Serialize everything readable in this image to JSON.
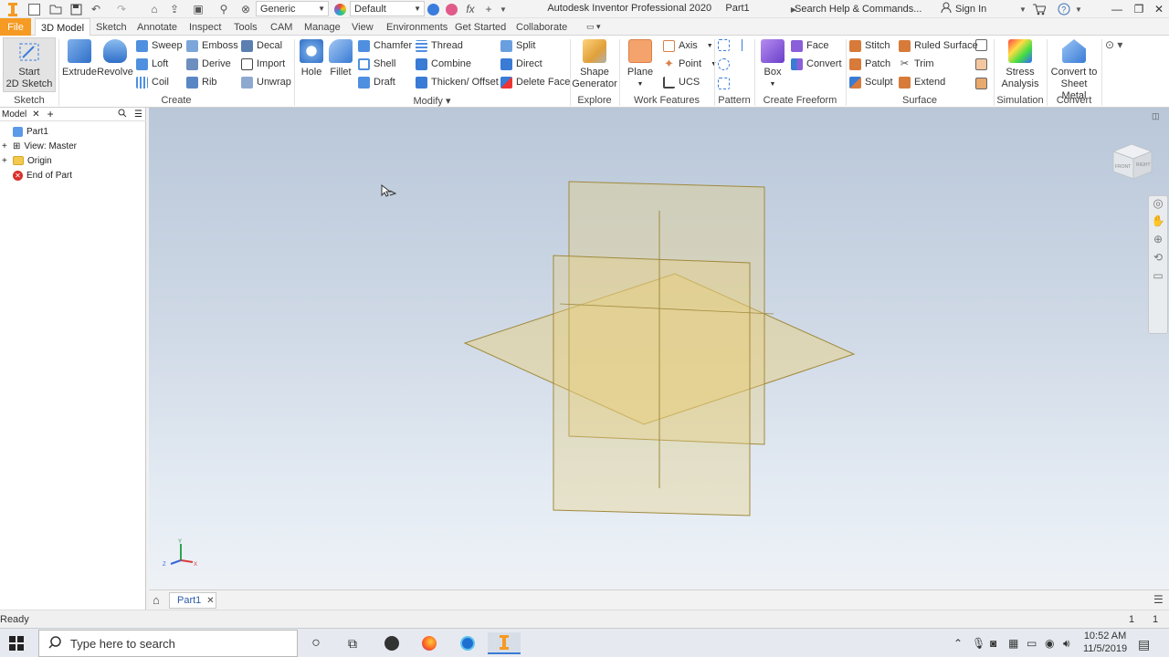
{
  "titlebar": {
    "app_title": "Autodesk Inventor Professional 2020",
    "doc_name": "Part1",
    "material_combo": "Generic",
    "appearance_combo": "Default",
    "search_placeholder": "Search Help & Commands...",
    "sign_in": "Sign In"
  },
  "tabs": [
    "File",
    "3D Model",
    "Sketch",
    "Annotate",
    "Inspect",
    "Tools",
    "CAM",
    "Manage",
    "View",
    "Environments",
    "Get Started",
    "Collaborate"
  ],
  "active_tab": "3D Model",
  "ribbon": {
    "sketch": {
      "start_label_1": "Start",
      "start_label_2": "2D Sketch",
      "group": "Sketch"
    },
    "create": {
      "extrude": "Extrude",
      "revolve": "Revolve",
      "sweep": "Sweep",
      "loft": "Loft",
      "coil": "Coil",
      "emboss": "Emboss",
      "derive": "Derive",
      "rib": "Rib",
      "decal": "Decal",
      "import": "Import",
      "unwrap": "Unwrap",
      "group": "Create"
    },
    "modify": {
      "hole": "Hole",
      "fillet": "Fillet",
      "chamfer": "Chamfer",
      "shell": "Shell",
      "draft": "Draft",
      "thread": "Thread",
      "combine": "Combine",
      "thicken": "Thicken/ Offset",
      "split": "Split",
      "direct": "Direct",
      "delete_face": "Delete Face",
      "group": "Modify"
    },
    "explore": {
      "shape_gen_1": "Shape",
      "shape_gen_2": "Generator",
      "group": "Explore"
    },
    "work": {
      "plane": "Plane",
      "axis": "Axis",
      "point": "Point",
      "ucs": "UCS",
      "group": "Work Features"
    },
    "pattern": {
      "group": "Pattern"
    },
    "freeform": {
      "box": "Box",
      "face": "Face",
      "convert": "Convert",
      "group": "Create Freeform"
    },
    "surface": {
      "stitch": "Stitch",
      "patch": "Patch",
      "sculpt": "Sculpt",
      "ruled": "Ruled Surface",
      "trim": "Trim",
      "extend": "Extend",
      "group": "Surface"
    },
    "simulation": {
      "stress_1": "Stress",
      "stress_2": "Analysis",
      "group": "Simulation"
    },
    "convert": {
      "sheet_1": "Convert to",
      "sheet_2": "Sheet Metal",
      "group": "Convert"
    }
  },
  "browser": {
    "tab_label": "Model",
    "items": [
      {
        "label": "Part1"
      },
      {
        "label": "View: Master"
      },
      {
        "label": "Origin"
      },
      {
        "label": "End of Part"
      }
    ]
  },
  "docbar": {
    "doc_tab": "Part1"
  },
  "status": {
    "text": "Ready",
    "count_a": "1",
    "count_b": "1"
  },
  "viewcube": {
    "front": "FRONT",
    "right": "RIGHT"
  },
  "triad": {
    "x": "X",
    "y": "Y",
    "z": "Z"
  },
  "taskbar": {
    "search_placeholder": "Type here to search",
    "time": "10:52 AM",
    "date": "11/5/2019"
  },
  "colors": {
    "file_tab": "#f59a23",
    "plane_fill": "#e8cf7a",
    "plane_stroke": "#a08a3c",
    "viewport_top": "#b9c7d9",
    "viewport_bottom": "#eef2f7"
  }
}
